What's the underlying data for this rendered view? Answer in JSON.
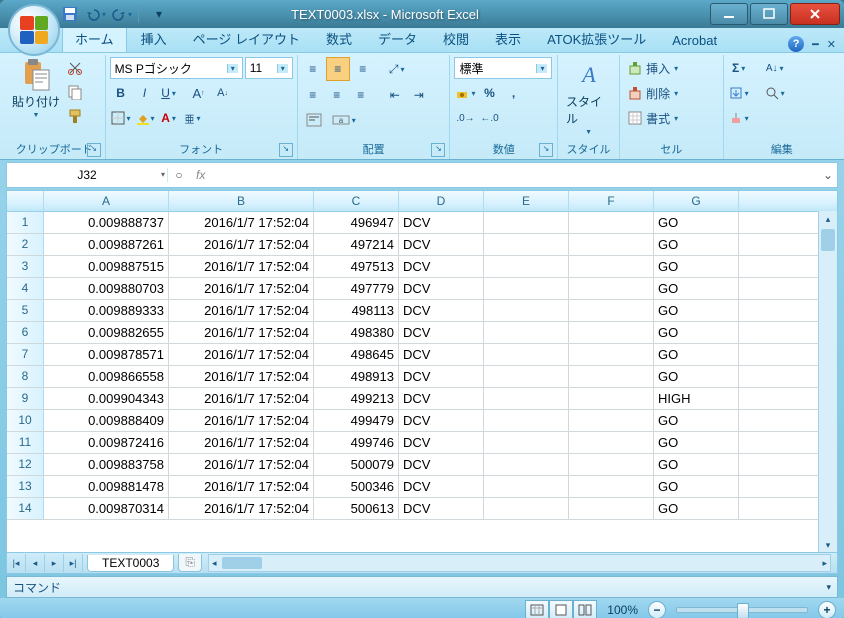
{
  "window": {
    "title": "TEXT0003.xlsx - Microsoft Excel"
  },
  "qat": {
    "save_icon": "save",
    "undo_icon": "undo",
    "redo_icon": "redo"
  },
  "tabs": [
    "ホーム",
    "挿入",
    "ページ レイアウト",
    "数式",
    "データ",
    "校閲",
    "表示",
    "ATOK拡張ツール",
    "Acrobat"
  ],
  "active_tab_index": 0,
  "ribbon": {
    "clipboard": {
      "label": "クリップボード",
      "paste": "貼り付け"
    },
    "font": {
      "label": "フォント",
      "name": "MS Pゴシック",
      "size": "11"
    },
    "align": {
      "label": "配置"
    },
    "number": {
      "label": "数値",
      "format": "標準"
    },
    "style": {
      "label": "スタイル",
      "btn": "スタイル"
    },
    "cells": {
      "label": "セル",
      "insert": "挿入",
      "delete": "削除",
      "format": "書式"
    },
    "edit": {
      "label": "編集"
    }
  },
  "namebox": {
    "value": "J32"
  },
  "formula_bar": {
    "fx": "fx",
    "value": ""
  },
  "grid": {
    "columns": [
      "A",
      "B",
      "C",
      "D",
      "E",
      "F",
      "G"
    ],
    "rows": [
      {
        "n": 1,
        "A": "0.009888737",
        "B": "2016/1/7 17:52:04",
        "C": "496947",
        "D": "DCV",
        "E": "",
        "F": "",
        "G": "GO"
      },
      {
        "n": 2,
        "A": "0.009887261",
        "B": "2016/1/7 17:52:04",
        "C": "497214",
        "D": "DCV",
        "E": "",
        "F": "",
        "G": "GO"
      },
      {
        "n": 3,
        "A": "0.009887515",
        "B": "2016/1/7 17:52:04",
        "C": "497513",
        "D": "DCV",
        "E": "",
        "F": "",
        "G": "GO"
      },
      {
        "n": 4,
        "A": "0.009880703",
        "B": "2016/1/7 17:52:04",
        "C": "497779",
        "D": "DCV",
        "E": "",
        "F": "",
        "G": "GO"
      },
      {
        "n": 5,
        "A": "0.009889333",
        "B": "2016/1/7 17:52:04",
        "C": "498113",
        "D": "DCV",
        "E": "",
        "F": "",
        "G": "GO"
      },
      {
        "n": 6,
        "A": "0.009882655",
        "B": "2016/1/7 17:52:04",
        "C": "498380",
        "D": "DCV",
        "E": "",
        "F": "",
        "G": "GO"
      },
      {
        "n": 7,
        "A": "0.009878571",
        "B": "2016/1/7 17:52:04",
        "C": "498645",
        "D": "DCV",
        "E": "",
        "F": "",
        "G": "GO"
      },
      {
        "n": 8,
        "A": "0.009866558",
        "B": "2016/1/7 17:52:04",
        "C": "498913",
        "D": "DCV",
        "E": "",
        "F": "",
        "G": "GO"
      },
      {
        "n": 9,
        "A": "0.009904343",
        "B": "2016/1/7 17:52:04",
        "C": "499213",
        "D": "DCV",
        "E": "",
        "F": "",
        "G": "HIGH"
      },
      {
        "n": 10,
        "A": "0.009888409",
        "B": "2016/1/7 17:52:04",
        "C": "499479",
        "D": "DCV",
        "E": "",
        "F": "",
        "G": "GO"
      },
      {
        "n": 11,
        "A": "0.009872416",
        "B": "2016/1/7 17:52:04",
        "C": "499746",
        "D": "DCV",
        "E": "",
        "F": "",
        "G": "GO"
      },
      {
        "n": 12,
        "A": "0.009883758",
        "B": "2016/1/7 17:52:04",
        "C": "500079",
        "D": "DCV",
        "E": "",
        "F": "",
        "G": "GO"
      },
      {
        "n": 13,
        "A": "0.009881478",
        "B": "2016/1/7 17:52:04",
        "C": "500346",
        "D": "DCV",
        "E": "",
        "F": "",
        "G": "GO"
      },
      {
        "n": 14,
        "A": "0.009870314",
        "B": "2016/1/7 17:52:04",
        "C": "500613",
        "D": "DCV",
        "E": "",
        "F": "",
        "G": "GO"
      }
    ]
  },
  "sheets": {
    "active": "TEXT0003"
  },
  "command_bar": {
    "text": "コマンド"
  },
  "status": {
    "zoom": "100%"
  }
}
